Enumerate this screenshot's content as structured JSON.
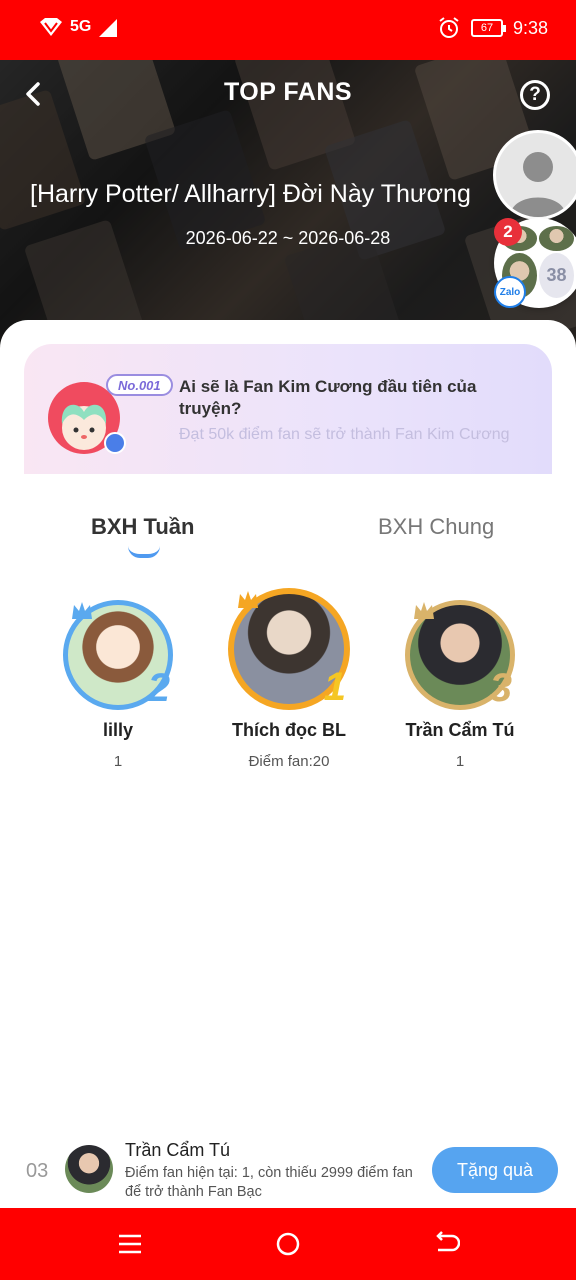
{
  "status_bar": {
    "network": "5G",
    "battery": "67",
    "time": "9:38"
  },
  "header": {
    "title": "TOP FANS",
    "story_title": "[Harry Potter/ Allharry] Đời Này Thương",
    "date_range": "2026-06-22 ~ 2026-06-28",
    "help_icon": "?"
  },
  "zalo_bubble": {
    "badge_count": "2",
    "member_count": "38",
    "logo": "Zalo"
  },
  "promo": {
    "tag": "No.001",
    "title": "Ai sẽ là Fan Kim Cương đầu tiên của truyện?",
    "subtitle": "Đạt 50k điểm fan sẽ trở thành Fan Kim Cương"
  },
  "tabs": {
    "week": "BXH Tuần",
    "all": "BXH Chung",
    "active": "week"
  },
  "top_fans": [
    {
      "rank": "2",
      "name": "lilly",
      "score": "1",
      "ring_color": "#5aa9ef"
    },
    {
      "rank": "1",
      "name": "Thích đọc BL",
      "score": "Điểm fan:20",
      "ring_color": "#f5a623"
    },
    {
      "rank": "3",
      "name": "Trần Cẩm Tú",
      "score": "1",
      "ring_color": "#d9b36a"
    }
  ],
  "my_rank": {
    "position": "03",
    "name": "Trần Cẩm Tú",
    "description": "Điểm fan hiện tại: 1, còn thiếu 2999 điểm fan để trở thành Fan Bạc",
    "gift_button": "Tặng quà"
  },
  "nav_bar": {
    "icons": [
      "menu-icon",
      "home-icon",
      "back-icon"
    ]
  }
}
